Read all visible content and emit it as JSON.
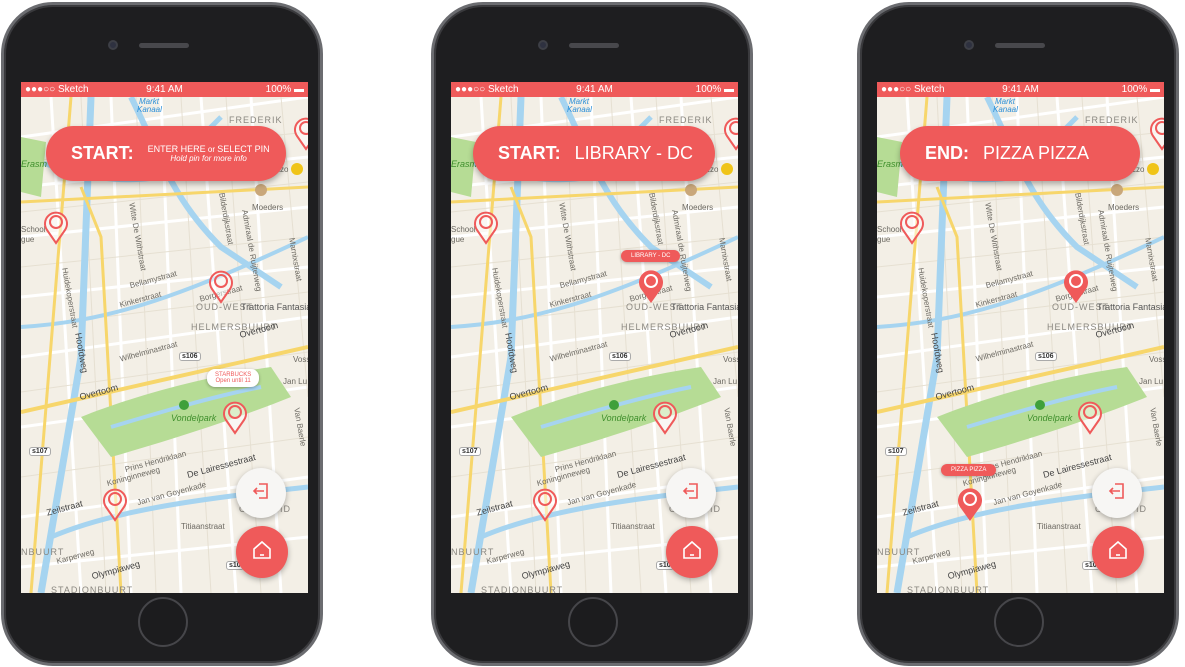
{
  "accent": "#ef5a5a",
  "status": {
    "carrier": "●●●○○ Sketch",
    "time": "9:41 AM",
    "battery": "100%"
  },
  "map_labels": {
    "markt": "Markt",
    "kanaal": "Kanaal",
    "frederik": "FREDERIK",
    "erasmus": "Erasm",
    "moeders": "Moeders",
    "pizzeria": "zzo",
    "school": "School",
    "gue": "gue",
    "bellamy": "Bellamystraat",
    "kinker": "Kinkerstraat",
    "borger": "Borgerstraat",
    "oudwest": "OUD-WEST",
    "trattoria": "Trattoria Fantasia",
    "helmers": "HELMERSBUURT",
    "overtoom1": "Overtoom",
    "overtoom2": "Overtoom",
    "hoofdweg": "Hoofdweg",
    "wilhelmina": "Wilhelminastraat",
    "s106": "s106",
    "vondelpark": "Vondelpark",
    "s107": "s107",
    "prins": "Prins Hendriklaan",
    "lairesse": "De Lairessestraat",
    "goyen": "Jan van Goyenkade",
    "koningin": "Koninginneweg",
    "zeil": "Zeilstraat",
    "oudzuid": "OUD-ZUID",
    "titiaan": "Titiaanstraat",
    "nbuurt": "NBUURT",
    "olympia": "Olympiaweg",
    "karper": "Karperweg",
    "stadion": "STADIONBUURT",
    "s10": "s10",
    "vanbaerle": "Van Baerle",
    "marnix": "Marnixstraat",
    "hoofd2": "Huidekoperstraat",
    "vossius": "Vossius",
    "witte": "Witte De Withstraat",
    "bilder": "Bilderdijkstraat",
    "admiraal": "Admiraal de Ruijterweg",
    "jacob": "Jan Lu"
  },
  "phones": [
    {
      "pill": {
        "key": "START:",
        "line1_a": "ENTER HERE",
        "line1_or": " or ",
        "line1_b": "SELECT PIN",
        "line2": "Hold pin for more info"
      },
      "tooltip": {
        "title": "STARBUCKS",
        "subtitle": "Open until 11"
      }
    },
    {
      "pill": {
        "key": "START:",
        "value": "LIBRARY - DC"
      },
      "tooltip": {
        "title": "LIBRARY - DC"
      }
    },
    {
      "pill": {
        "key": "END:",
        "value": "PIZZA PIZZA"
      },
      "tooltip": {
        "title": "PIZZA PIZZA"
      }
    }
  ],
  "icons": {
    "exit": "exit-icon",
    "home": "home-icon",
    "pin": "map-pin-icon"
  }
}
